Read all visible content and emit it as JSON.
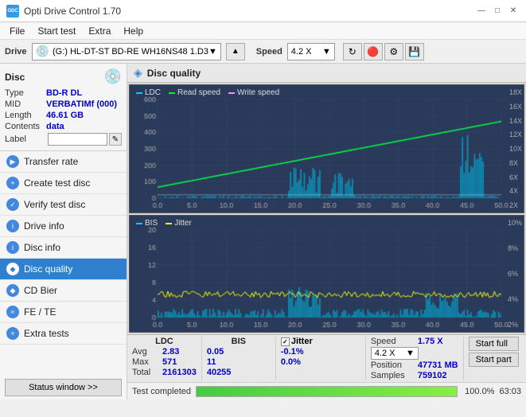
{
  "app": {
    "title": "Opti Drive Control 1.70",
    "title_icon": "ODC"
  },
  "title_controls": {
    "minimize": "—",
    "maximize": "□",
    "close": "✕"
  },
  "menu": {
    "items": [
      "File",
      "Start test",
      "Extra",
      "Help"
    ]
  },
  "drive_toolbar": {
    "drive_label": "Drive",
    "drive_value": "(G:) HL-DT-ST BD-RE  WH16NS48 1.D3",
    "speed_label": "Speed",
    "speed_value": "4.2 X"
  },
  "disc_section": {
    "title": "Disc",
    "type_label": "Type",
    "type_value": "BD-R DL",
    "mid_label": "MID",
    "mid_value": "VERBATIMf (000)",
    "length_label": "Length",
    "length_value": "46.61 GB",
    "contents_label": "Contents",
    "contents_value": "data",
    "label_label": "Label"
  },
  "sidebar": {
    "items": [
      {
        "id": "transfer-rate",
        "label": "Transfer rate",
        "icon": "▶",
        "icon_color": "blue",
        "active": false
      },
      {
        "id": "create-test-disc",
        "label": "Create test disc",
        "icon": "+",
        "icon_color": "blue",
        "active": false
      },
      {
        "id": "verify-test-disc",
        "label": "Verify test disc",
        "icon": "✓",
        "icon_color": "blue",
        "active": false
      },
      {
        "id": "drive-info",
        "label": "Drive info",
        "icon": "i",
        "icon_color": "blue",
        "active": false
      },
      {
        "id": "disc-info",
        "label": "Disc info",
        "icon": "i",
        "icon_color": "blue",
        "active": false
      },
      {
        "id": "disc-quality",
        "label": "Disc quality",
        "icon": "◆",
        "icon_color": "blue",
        "active": true
      },
      {
        "id": "cd-bier",
        "label": "CD Bier",
        "icon": "◆",
        "icon_color": "blue",
        "active": false
      },
      {
        "id": "fe-te",
        "label": "FE / TE",
        "icon": "≈",
        "icon_color": "blue",
        "active": false
      },
      {
        "id": "extra-tests",
        "label": "Extra tests",
        "icon": "+",
        "icon_color": "blue",
        "active": false
      }
    ],
    "status_button": "Status window >>"
  },
  "content": {
    "title": "Disc quality",
    "chart1": {
      "legend": [
        {
          "id": "ldc",
          "label": "LDC",
          "color": "#00ccff"
        },
        {
          "id": "read-speed",
          "label": "Read speed",
          "color": "#00ff00"
        },
        {
          "id": "write-speed",
          "label": "Write speed",
          "color": "#ff88ff"
        }
      ],
      "y_axis_left_max": 600,
      "y_axis_right_labels": [
        "18X",
        "16X",
        "14X",
        "12X",
        "10X",
        "8X",
        "6X",
        "4X",
        "2X"
      ],
      "x_axis_max": "50.0",
      "x_axis_unit": "GB"
    },
    "chart2": {
      "legend": [
        {
          "id": "bis",
          "label": "BIS",
          "color": "#00ccff"
        },
        {
          "id": "jitter",
          "label": "Jitter",
          "color": "#ffff00"
        }
      ],
      "y_axis_left_max": 20,
      "y_axis_right_labels": [
        "10%",
        "8%",
        "6%",
        "4%",
        "2%"
      ],
      "x_axis_max": "50.0",
      "x_axis_unit": "GB"
    }
  },
  "stats": {
    "headers": [
      "LDC",
      "BIS",
      "",
      "Jitter",
      "Speed",
      ""
    ],
    "avg_label": "Avg",
    "avg_ldc": "2.83",
    "avg_bis": "0.05",
    "avg_jitter": "-0.1%",
    "max_label": "Max",
    "max_ldc": "571",
    "max_bis": "11",
    "max_jitter": "0.0%",
    "total_label": "Total",
    "total_ldc": "2161303",
    "total_bis": "40255",
    "speed_label": "Speed",
    "speed_value": "1.75 X",
    "speed_select": "4.2 X",
    "position_label": "Position",
    "position_value": "47731 MB",
    "samples_label": "Samples",
    "samples_value": "759102",
    "start_full": "Start full",
    "start_part": "Start part"
  },
  "progress": {
    "label": "Test completed",
    "percent": 100,
    "percent_text": "100.0%",
    "timer": "63:03"
  }
}
